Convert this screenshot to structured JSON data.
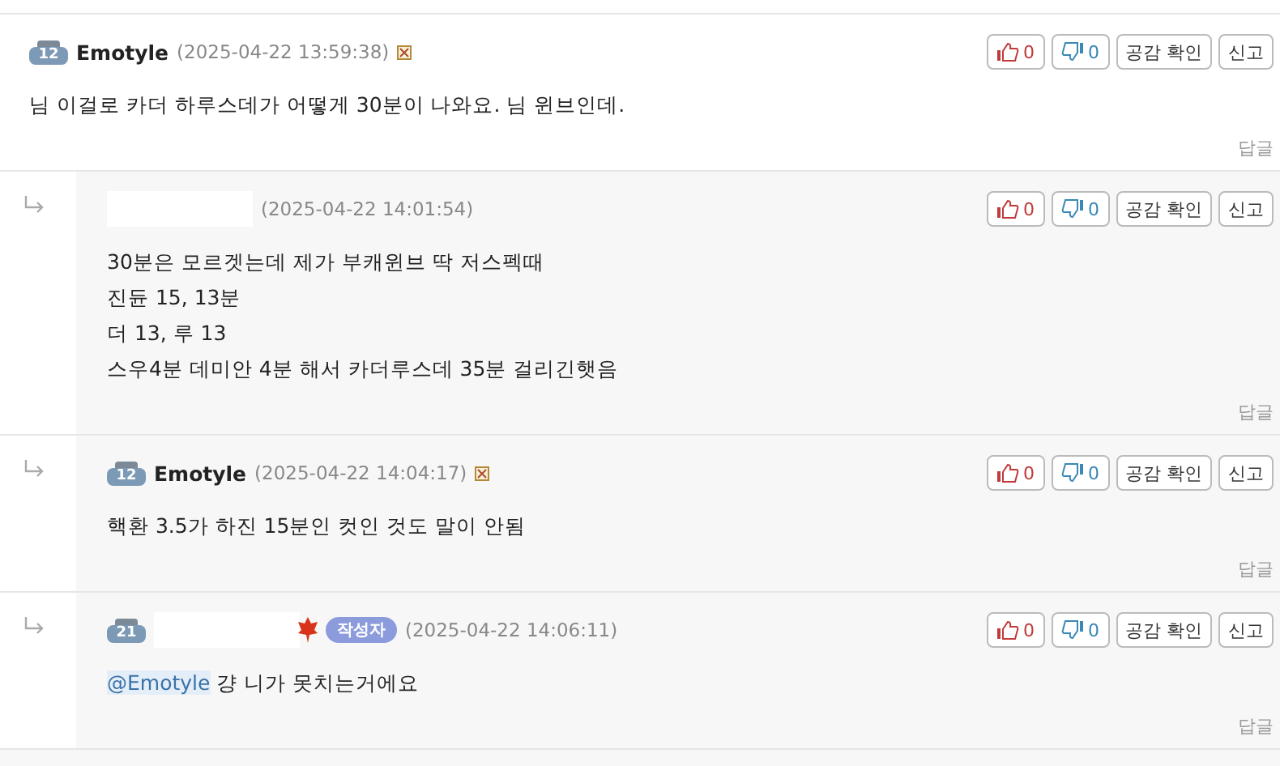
{
  "comments": [
    {
      "kind": "comment",
      "level": "12",
      "author": "Emotyle",
      "time": "(2025-04-22 13:59:38)",
      "flag": true,
      "lines": [
        "님 이걸로 카더 하루스데가 어떻게 30분이 나와요. 님 윈브인데."
      ],
      "likes": "0",
      "dislikes": "0",
      "buttons": [
        "공감 확인",
        "신고"
      ],
      "reply": "답글"
    },
    {
      "kind": "reply",
      "name_hidden": true,
      "time": "(2025-04-22 14:01:54)",
      "lines": [
        "30분은 모르겟는데 제가 부캐윈브 딱 저스펙때",
        "진듄 15, 13분",
        "더 13, 루 13",
        "스우4분 데미안 4분 해서 카더루스데 35분 걸리긴햇음"
      ],
      "likes": "0",
      "dislikes": "0",
      "buttons": [
        "공감 확인",
        "신고"
      ],
      "reply": "답글"
    },
    {
      "kind": "reply",
      "level": "12",
      "author": "Emotyle",
      "time": "(2025-04-22 14:04:17)",
      "flag": true,
      "lines": [
        "핵환 3.5가 하진 15분인 컷인 것도 말이 안됨"
      ],
      "likes": "0",
      "dislikes": "0",
      "buttons": [
        "공감 확인",
        "신고"
      ],
      "reply": "답글"
    },
    {
      "kind": "reply",
      "level": "21",
      "name_hidden": true,
      "leaf": true,
      "badge": "작성자",
      "time": "(2025-04-22 14:06:11)",
      "mention": "@Emotyle",
      "lines": [
        "걍 니가 못치는거에요"
      ],
      "likes": "0",
      "dislikes": "0",
      "buttons": [
        "공감 확인",
        "신고"
      ],
      "reply": "답글"
    }
  ]
}
